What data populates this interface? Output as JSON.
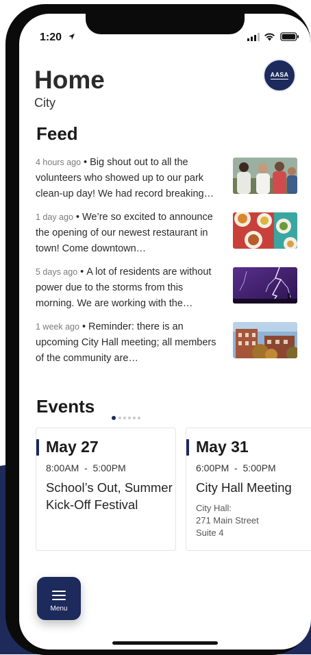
{
  "status": {
    "time": "1:20"
  },
  "header": {
    "title": "Home",
    "subtitle": "City",
    "avatar_text": "AASA"
  },
  "feed": {
    "title": "Feed",
    "items": [
      {
        "time": "4 hours ago",
        "text": "Big shout out to all the volunteers who showed up to our park clean-up day! We had record breaking…",
        "image": "volunteers-photo"
      },
      {
        "time": "1 day ago",
        "text": "We’re so excited to announce the opening of our newest restaurant in town! Come downtown…",
        "image": "restaurant-food-photo"
      },
      {
        "time": "5 days ago",
        "text": "A lot of residents are without power due to the storms from this morning. We are working with the…",
        "image": "lightning-storm-photo"
      },
      {
        "time": "1 week ago",
        "text": "Reminder: there is an upcoming City Hall meeting; all members of the community are…",
        "image": "city-hall-photo"
      }
    ]
  },
  "events": {
    "title": "Events",
    "page_count": 6,
    "active_page": 0,
    "cards": [
      {
        "date": "May 27",
        "time": "8:00AM  -  5:00PM",
        "name": "School’s Out, Summer Kick-Off Festival",
        "location_lines": []
      },
      {
        "date": "May 31",
        "time": "6:00PM  -  5:00PM",
        "name": "City Hall Meeting",
        "location_lines": [
          "City Hall:",
          "271 Main Street",
          "Suite 4"
        ]
      }
    ]
  },
  "menu": {
    "label": "Menu"
  },
  "colors": {
    "brand_navy": "#1c2a5c",
    "text_dark": "#1a1a1a",
    "muted": "#7a7a7a"
  }
}
